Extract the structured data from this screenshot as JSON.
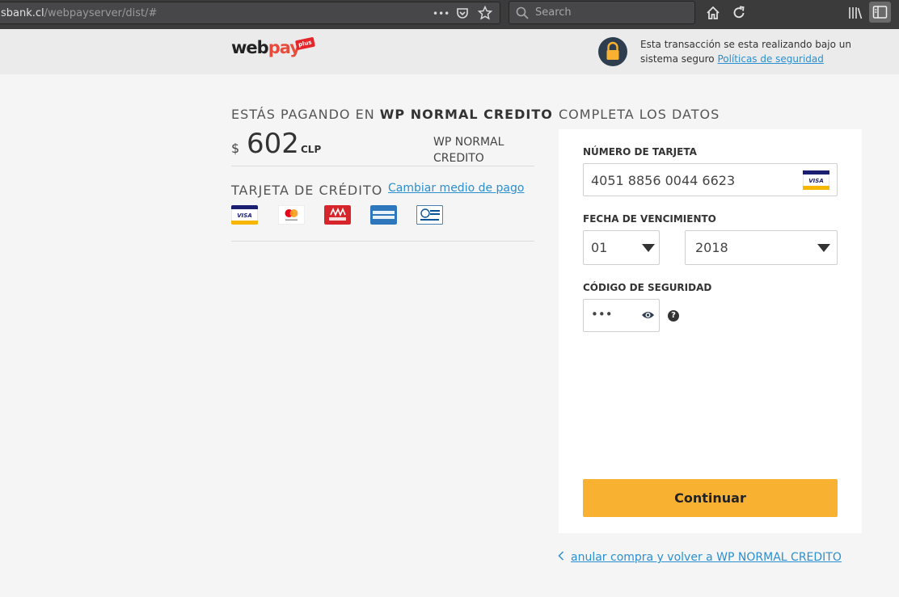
{
  "browser": {
    "url_host": "sbank.cl",
    "url_path": "/webpayserver/dist/#",
    "more_label": "•••",
    "search_placeholder": "Search"
  },
  "header": {
    "logo_web": "web",
    "logo_pay": "pay",
    "logo_plus": "plus",
    "secure_text": "Esta transacción se esta realizando bajo un sistema seguro",
    "secure_link": "Políticas de seguridad"
  },
  "payment": {
    "title_prefix": "ESTÁS PAGANDO EN",
    "merchant": "WP NORMAL CREDITO",
    "currency_symbol": "$",
    "amount": "602",
    "currency_code": "CLP",
    "merchant_name": "WP NORMAL CREDITO",
    "card_type_label": "TARJETA DE CRÉDITO",
    "change_method_label": "Cambiar medio de pago",
    "cards": [
      {
        "name": "VISA"
      },
      {
        "name": "mastercard"
      },
      {
        "name": "MAGNA"
      },
      {
        "name": "AMERICAN EXPRESS"
      },
      {
        "name": "Diners Club"
      }
    ]
  },
  "form": {
    "title": "COMPLETA LOS DATOS",
    "card_number_label": "NÚMERO DE TARJETA",
    "card_number_value": "4051 8856 0044 6623",
    "card_brand": "VISA",
    "expiry_label": "FECHA DE VENCIMIENTO",
    "expiry_month": "01",
    "expiry_year": "2018",
    "cvv_label": "CÓDIGO DE SEGURIDAD",
    "cvv_value": "•••",
    "help_symbol": "?",
    "continue_label": "Continuar",
    "cancel_label": "anular compra y volver a WP NORMAL CREDITO"
  },
  "colors": {
    "accent_button": "#f9b132",
    "link": "#2b8fd0",
    "lock_badge": "#2e3e4e"
  }
}
